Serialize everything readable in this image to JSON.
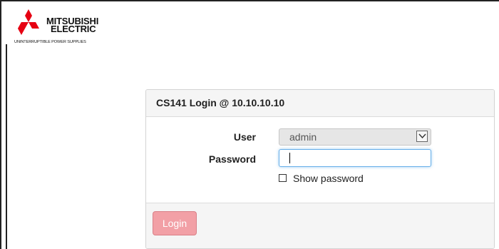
{
  "brand": {
    "line1": "MITSUBISHI",
    "line2": "ELECTRIC",
    "tagline": "UNINTERRUPTIBLE POWER SUPPLIES",
    "logo_color": "#e60012"
  },
  "login": {
    "title": "CS141 Login @ 10.10.10.10",
    "user_label": "User",
    "user_value": "admin",
    "password_label": "Password",
    "password_value": "",
    "show_password_label": "Show password",
    "show_password_checked": false,
    "login_button": "Login"
  },
  "colors": {
    "button_bg": "#f2a0a6",
    "focus_border": "#66afe9"
  }
}
